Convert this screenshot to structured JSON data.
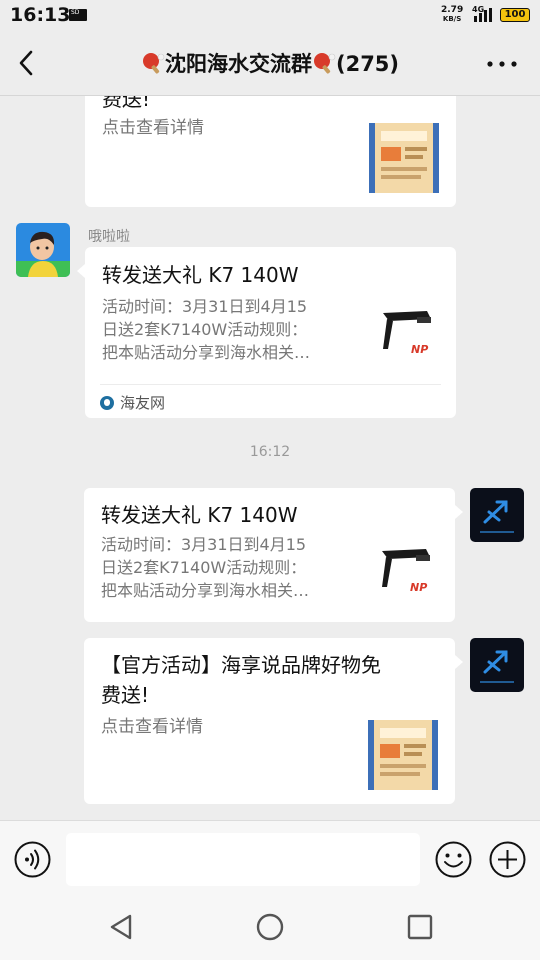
{
  "status_bar": {
    "time": "16:13",
    "net_rate_value": "2.79",
    "net_rate_unit": "KB/S",
    "network_type": "4G",
    "battery": "100"
  },
  "header": {
    "title": "沈阳海水交流群",
    "member_count": "(275)"
  },
  "messages": [
    {
      "type": "link-card",
      "side": "left",
      "title_tail": "费送!",
      "desc": "点击查看详情"
    },
    {
      "type": "link-card",
      "side": "left",
      "sender": "哦啦啦",
      "title": "转发送大礼 K7 140W",
      "desc_lines": [
        "活动时间：3月31日到4月15",
        "日送2套K7140W活动规则：",
        "把本贴活动分享到海水相关…"
      ],
      "source": "海友网"
    },
    {
      "type": "timestamp",
      "text": "16:12"
    },
    {
      "type": "link-card",
      "side": "right",
      "title": "转发送大礼 K7 140W",
      "desc_lines": [
        "活动时间：3月31日到4月15",
        "日送2套K7140W活动规则：",
        "把本贴活动分享到海水相关…"
      ]
    },
    {
      "type": "link-card",
      "side": "right",
      "title_lines": [
        "【官方活动】海享说品牌好物免",
        "费送!"
      ],
      "desc": "点击查看详情"
    }
  ],
  "input": {
    "value": "",
    "placeholder": ""
  },
  "icons": {
    "back": "chevron-left-icon",
    "more": "more-dots-icon",
    "voice": "voice-icon",
    "emoji": "emoji-icon",
    "plus": "plus-icon",
    "nav_back": "triangle-back-icon",
    "nav_home": "circle-home-icon",
    "nav_recent": "square-recent-icon"
  },
  "colors": {
    "chat_background": "#ededed",
    "bubble": "#ffffff",
    "battery": "#f4c20d",
    "brand_red": "#d83a2a",
    "app_avatar": "#0b0f1a"
  }
}
